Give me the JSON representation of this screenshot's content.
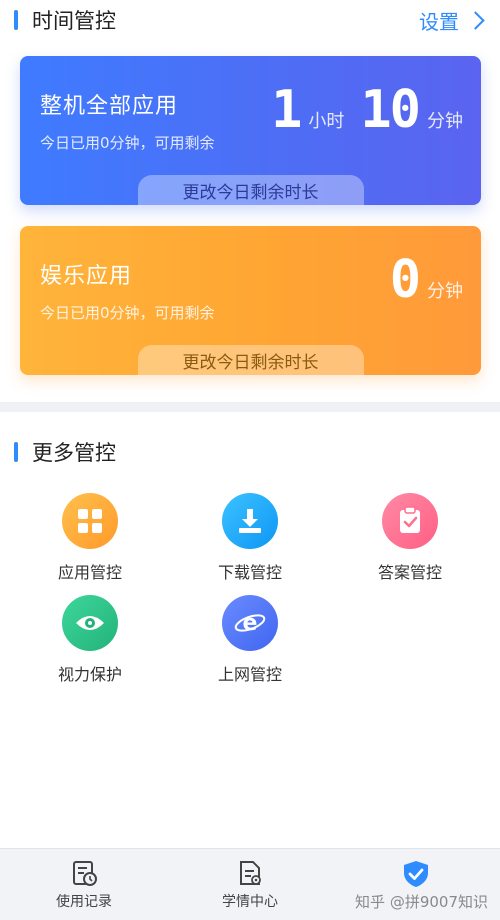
{
  "header": {
    "title": "时间管控",
    "settings_label": "设置"
  },
  "cards": [
    {
      "title": "整机全部应用",
      "subtitle": "今日已用0分钟，可用剩余",
      "hours": "1",
      "hours_unit": "小时",
      "minutes": "10",
      "minutes_unit": "分钟",
      "button": "更改今日剩余时长"
    },
    {
      "title": "娱乐应用",
      "subtitle": "今日已用0分钟，可用剩余",
      "minutes": "0",
      "minutes_unit": "分钟",
      "button": "更改今日剩余时长"
    }
  ],
  "more": {
    "title": "更多管控",
    "items": [
      {
        "label": "应用管控",
        "icon": "app-grid-icon",
        "color": "#ffa733"
      },
      {
        "label": "下载管控",
        "icon": "download-icon",
        "color": "#1fa8ff"
      },
      {
        "label": "答案管控",
        "icon": "clipboard-check-icon",
        "color": "#ff6f8e"
      },
      {
        "label": "视力保护",
        "icon": "eye-icon",
        "color": "#2ec48a"
      },
      {
        "label": "上网管控",
        "icon": "browser-e-icon",
        "color": "#4a78ff"
      }
    ]
  },
  "nav": {
    "items": [
      {
        "label": "使用记录",
        "icon": "record-icon"
      },
      {
        "label": "学情中心",
        "icon": "study-report-icon"
      },
      {
        "label": "",
        "icon": "shield-check-icon"
      }
    ]
  },
  "watermark": "知乎 @拼9007知识"
}
